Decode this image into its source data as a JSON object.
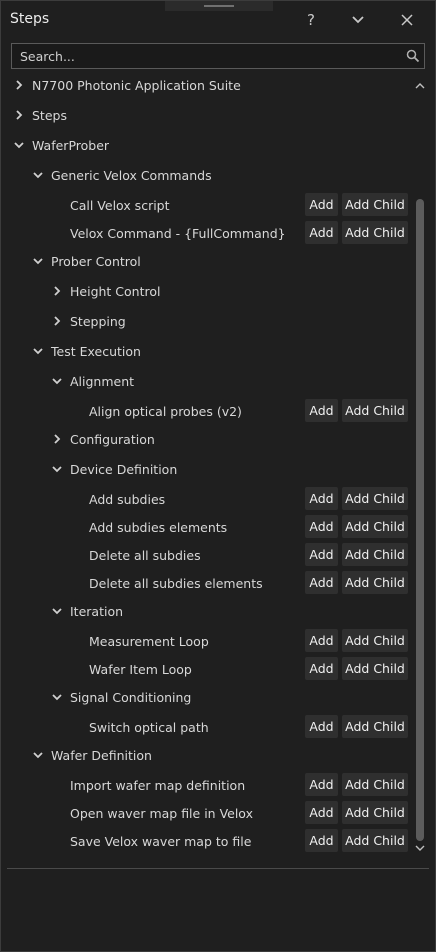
{
  "header": {
    "title": "Steps"
  },
  "search": {
    "placeholder": "Search..."
  },
  "buttons": {
    "add": "Add",
    "add_child": "Add Child"
  },
  "tree": [
    {
      "label": "N7700 Photonic Application Suite",
      "level": 0,
      "expander": "collapsed",
      "actions": false
    },
    {
      "label": "Steps",
      "level": 0,
      "expander": "collapsed",
      "actions": false
    },
    {
      "label": "WaferProber",
      "level": 0,
      "expander": "expanded",
      "actions": false
    },
    {
      "label": "Generic Velox Commands",
      "level": 1,
      "expander": "expanded",
      "actions": false
    },
    {
      "label": "Call Velox script",
      "level": 2,
      "expander": "none",
      "actions": true
    },
    {
      "label": "Velox Command - {FullCommand}",
      "level": 2,
      "expander": "none",
      "actions": true
    },
    {
      "label": "Prober Control",
      "level": 1,
      "expander": "expanded",
      "actions": false
    },
    {
      "label": "Height Control",
      "level": 2,
      "expander": "collapsed",
      "actions": false
    },
    {
      "label": "Stepping",
      "level": 2,
      "expander": "collapsed",
      "actions": false
    },
    {
      "label": "Test Execution",
      "level": 1,
      "expander": "expanded",
      "actions": false
    },
    {
      "label": "Alignment",
      "level": 2,
      "expander": "expanded",
      "actions": false
    },
    {
      "label": "Align optical probes (v2)",
      "level": 3,
      "expander": "none",
      "actions": true
    },
    {
      "label": "Configuration",
      "level": 2,
      "expander": "collapsed",
      "actions": false
    },
    {
      "label": "Device Definition",
      "level": 2,
      "expander": "expanded",
      "actions": false
    },
    {
      "label": "Add subdies",
      "level": 3,
      "expander": "none",
      "actions": true
    },
    {
      "label": "Add subdies elements",
      "level": 3,
      "expander": "none",
      "actions": true
    },
    {
      "label": "Delete all subdies",
      "level": 3,
      "expander": "none",
      "actions": true
    },
    {
      "label": "Delete all subdies elements",
      "level": 3,
      "expander": "none",
      "actions": true
    },
    {
      "label": "Iteration",
      "level": 2,
      "expander": "expanded",
      "actions": false
    },
    {
      "label": "Measurement Loop",
      "level": 3,
      "expander": "none",
      "actions": true
    },
    {
      "label": "Wafer Item Loop",
      "level": 3,
      "expander": "none",
      "actions": true
    },
    {
      "label": "Signal Conditioning",
      "level": 2,
      "expander": "expanded",
      "actions": false
    },
    {
      "label": "Switch optical path",
      "level": 3,
      "expander": "none",
      "actions": true
    },
    {
      "label": "Wafer Definition",
      "level": 1,
      "expander": "expanded",
      "actions": false
    },
    {
      "label": "Import wafer map definition",
      "level": 2,
      "expander": "none",
      "actions": true
    },
    {
      "label": "Open waver map file in Velox",
      "level": 2,
      "expander": "none",
      "actions": true
    },
    {
      "label": "Save Velox waver map to file",
      "level": 2,
      "expander": "none",
      "actions": true
    }
  ],
  "icons": {
    "help": "help-icon",
    "collapse": "chevron-down-icon",
    "close": "close-icon",
    "search": "search-icon"
  }
}
